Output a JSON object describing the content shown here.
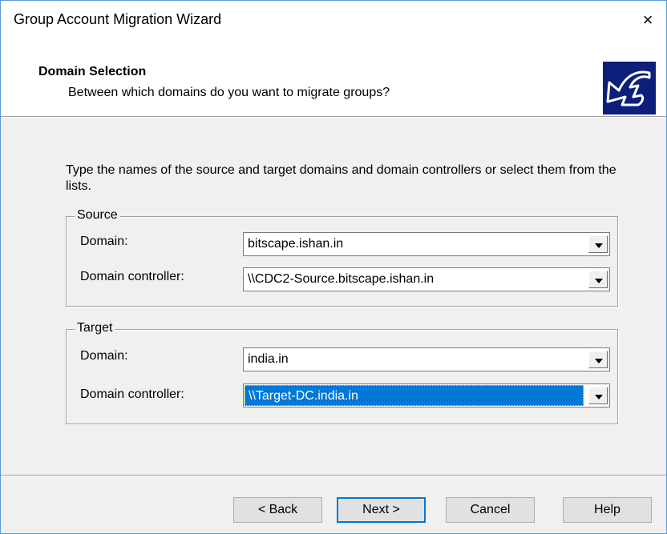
{
  "window": {
    "title": "Group Account Migration Wizard",
    "close_glyph": "×"
  },
  "header": {
    "title": "Domain Selection",
    "subtitle": "Between which domains do you want to migrate groups?",
    "icon": "migration-wizard-icon"
  },
  "instruction": "Type the names of the source and target domains and domain controllers or select them from the lists.",
  "source": {
    "legend": "Source",
    "domain_label": "Domain:",
    "domain_value": "bitscape.ishan.in",
    "dc_label": "Domain controller:",
    "dc_value": "\\\\CDC2-Source.bitscape.ishan.in"
  },
  "target": {
    "legend": "Target",
    "domain_label": "Domain:",
    "domain_value": "india.in",
    "dc_label": "Domain controller:",
    "dc_value": "\\\\Target-DC.india.in"
  },
  "buttons": {
    "back": "< Back",
    "next": "Next >",
    "cancel": "Cancel",
    "help": "Help"
  },
  "colors": {
    "selection": "#0078d7",
    "icon_bg": "#0d1f7a",
    "window_border": "#5b9bd5"
  }
}
